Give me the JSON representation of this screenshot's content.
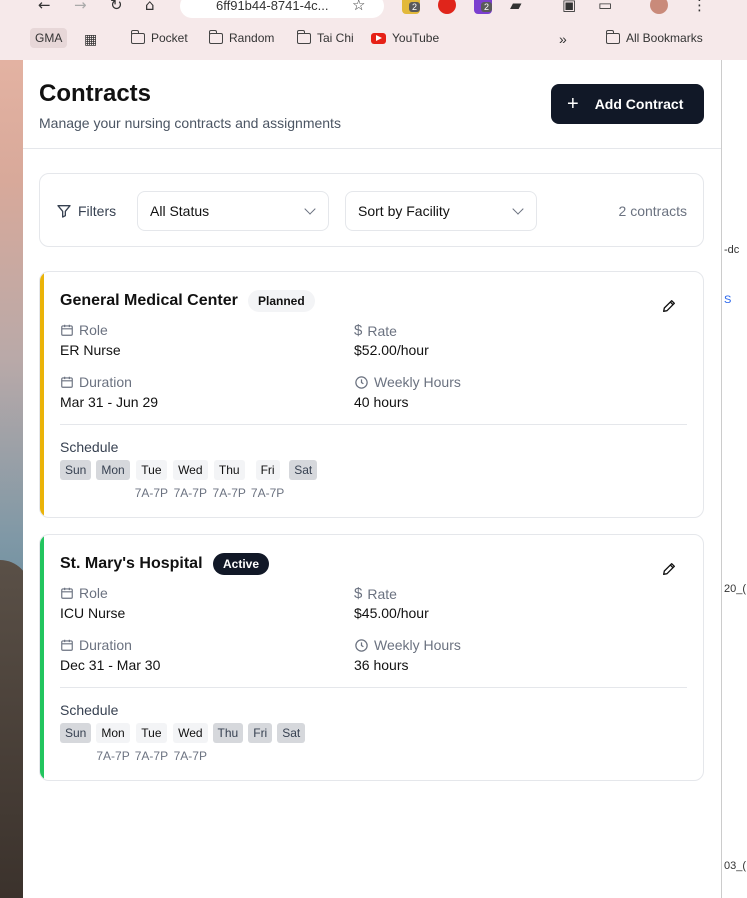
{
  "browser": {
    "url": "6ff91b44-8741-4c...",
    "ext_badge_1": "2",
    "ext_badge_2": "2",
    "bookmarks": [
      {
        "label": "GMA"
      },
      {
        "label": "Pocket"
      },
      {
        "label": "Random"
      },
      {
        "label": "Tai Chi"
      },
      {
        "label": "YouTube"
      },
      {
        "label": "All Bookmarks"
      }
    ],
    "right_window": [
      "-dc",
      "S",
      "20_(",
      "03_("
    ]
  },
  "header": {
    "title": "Contracts",
    "subtitle": "Manage your nursing contracts and assignments",
    "add_button": "Add Contract"
  },
  "filters": {
    "label": "Filters",
    "status_select": "All Status",
    "sort_select": "Sort by Facility",
    "count": "2 contracts"
  },
  "contracts": [
    {
      "facility": "General Medical Center",
      "status": "Planned",
      "accent_color": "#eab308",
      "role_label": "Role",
      "role": "ER Nurse",
      "rate_label": "Rate",
      "rate": "$52.00/hour",
      "duration_label": "Duration",
      "duration": "Mar 31 - Jun 29",
      "hours_label": "Weekly Hours",
      "hours": "40 hours",
      "schedule_label": "Schedule",
      "days": [
        {
          "day": "Sun",
          "time": "",
          "active": false
        },
        {
          "day": "Mon",
          "time": "",
          "active": false
        },
        {
          "day": "Tue",
          "time": "7A-7P",
          "active": true
        },
        {
          "day": "Wed",
          "time": "7A-7P",
          "active": true
        },
        {
          "day": "Thu",
          "time": "7A-7P",
          "active": true
        },
        {
          "day": "Fri",
          "time": "7A-7P",
          "active": true
        },
        {
          "day": "Sat",
          "time": "",
          "active": false
        }
      ]
    },
    {
      "facility": "St. Mary's Hospital",
      "status": "Active",
      "accent_color": "#22c55e",
      "role_label": "Role",
      "role": "ICU Nurse",
      "rate_label": "Rate",
      "rate": "$45.00/hour",
      "duration_label": "Duration",
      "duration": "Dec 31 - Mar 30",
      "hours_label": "Weekly Hours",
      "hours": "36 hours",
      "schedule_label": "Schedule",
      "days": [
        {
          "day": "Sun",
          "time": "",
          "active": false
        },
        {
          "day": "Mon",
          "time": "7A-7P",
          "active": true
        },
        {
          "day": "Tue",
          "time": "7A-7P",
          "active": true
        },
        {
          "day": "Wed",
          "time": "7A-7P",
          "active": true
        },
        {
          "day": "Thu",
          "time": "",
          "active": false
        },
        {
          "day": "Fri",
          "time": "",
          "active": false
        },
        {
          "day": "Sat",
          "time": "",
          "active": false
        }
      ]
    }
  ]
}
